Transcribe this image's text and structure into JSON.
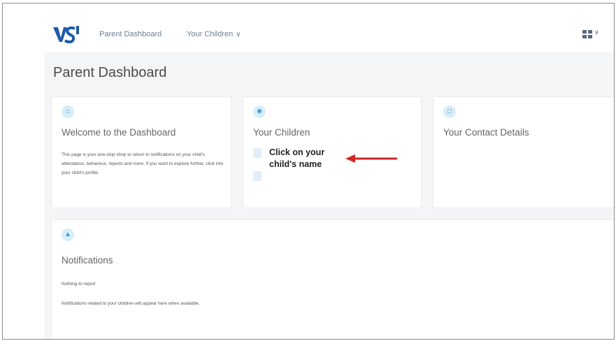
{
  "header": {
    "logo_alt": "VSware",
    "nav": {
      "dashboard": "Parent Dashboard",
      "children": "Your Children"
    }
  },
  "page": {
    "title": "Parent Dashboard"
  },
  "cards": {
    "welcome": {
      "title": "Welcome to the Dashboard",
      "text": "This page is your one-stop shop to return to notifications on your child's attendance, behaviour, reports and more. If you want to explore further, click into your child's profile."
    },
    "children": {
      "title": "Your Children",
      "callout": "Click on your child's name"
    },
    "contact": {
      "title": "Your Contact Details"
    },
    "notifications": {
      "title": "Notifications",
      "line1": "Nothing to report",
      "line2": "Notifications related to your children will appear here when available."
    }
  },
  "colors": {
    "accent": "#3a9ad0",
    "logo_blue": "#1e5aa8",
    "arrow_red": "#d0262a",
    "content_bg": "#f4f5f7"
  },
  "icons": {
    "welcome": "home-icon",
    "children": "person-icon",
    "contact": "contact-card-icon",
    "notifications": "bell-icon",
    "apps": "apps-grid-icon"
  }
}
